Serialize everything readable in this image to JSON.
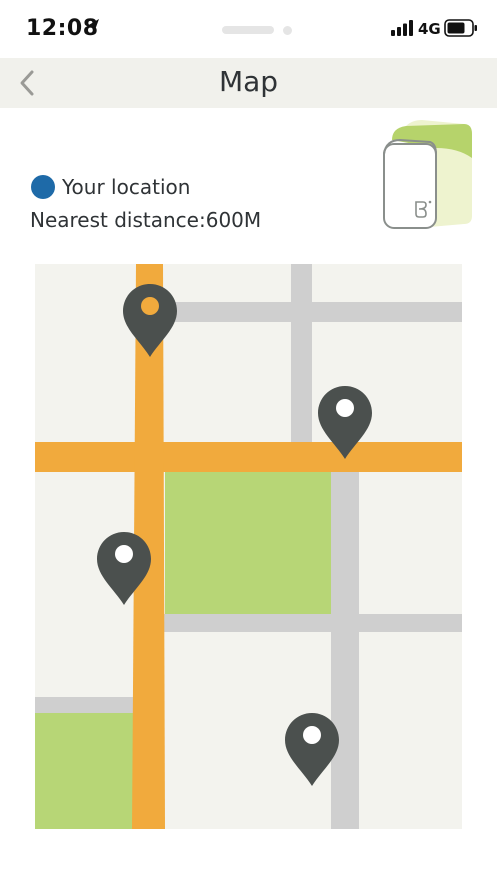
{
  "status_bar": {
    "time": "12:08",
    "network": "4G"
  },
  "nav": {
    "title": "Map",
    "back_icon": "chevron-left-icon"
  },
  "info": {
    "location_label": "Your location",
    "distance_text": "Nearest distance:600M"
  },
  "colors": {
    "nav_background": "#f1f1ec",
    "location_dot": "#1e6aa8",
    "map_background": "#f3f3ee",
    "main_road": "#f1aa3d",
    "minor_road": "#cfcfcf",
    "park": "#b7d676",
    "pin": "#4b504e"
  },
  "map": {
    "pins": [
      {
        "name": "user-location-pin",
        "type": "current-location"
      },
      {
        "name": "station-pin-1",
        "type": "station"
      },
      {
        "name": "station-pin-2",
        "type": "station"
      },
      {
        "name": "station-pin-3",
        "type": "station"
      }
    ]
  }
}
